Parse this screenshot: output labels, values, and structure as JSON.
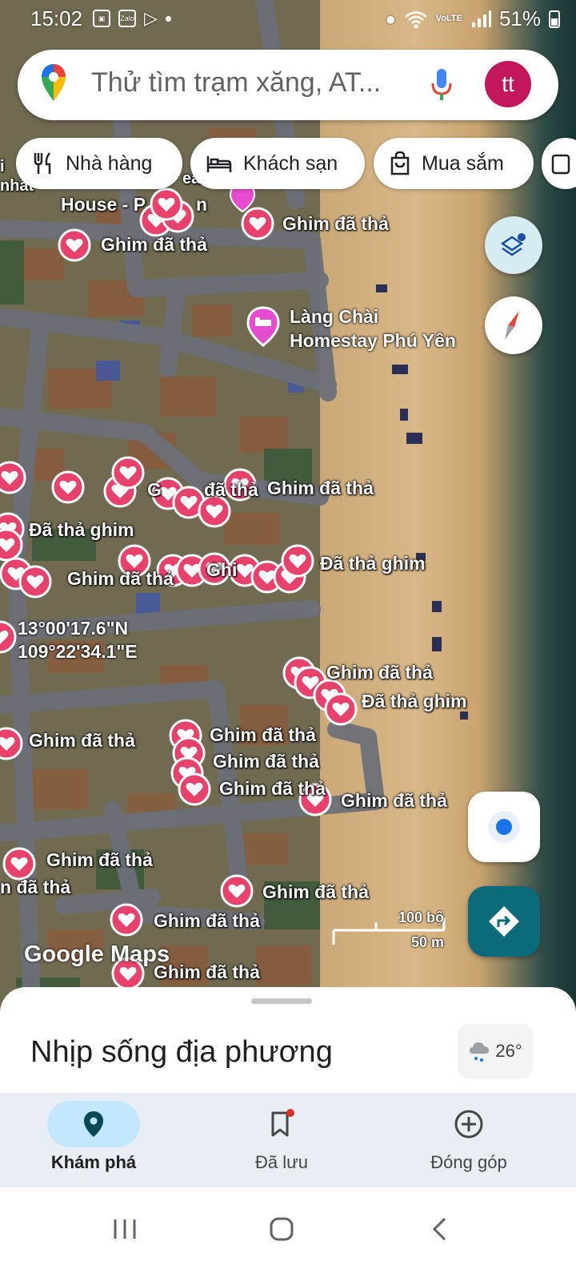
{
  "status_bar": {
    "time": "15:02",
    "app_icons": [
      "gallery-icon",
      "zalo-icon",
      "play-icon",
      "dot"
    ],
    "zalo_text": "Zalo",
    "network": "VoLTE",
    "battery": "51%"
  },
  "search": {
    "placeholder": "Thử tìm trạm xăng, AT...",
    "avatar_initials": "tt"
  },
  "chips": [
    {
      "label": "Nhà hàng",
      "icon": "fork-knife-icon"
    },
    {
      "label": "Khách sạn",
      "icon": "bed-icon"
    },
    {
      "label": "Mua sắm",
      "icon": "shopping-bag-icon"
    }
  ],
  "map": {
    "place_labels": {
      "fragment_left": "i\nnhất",
      "house": "House - P",
      "house_tail": "n",
      "reach": "each"
    },
    "poi": {
      "name_line1": "Làng Chài",
      "name_line2": "Homestay Phú Yên"
    },
    "coordinates": {
      "lat": "13°00'17.6\"N",
      "lng": "109°22'34.1\"E"
    },
    "pin_labels": [
      "Ghim đã thả",
      "Ghim đã thả",
      "Ghim đã thả",
      "Đã thả ghim",
      "Ghim đã thả",
      "Đã thả ghim",
      "Ghim đã thả",
      "Đã thả ghim",
      "Ghim đã thả",
      "Ghim đã thả",
      "Ghim đã thả",
      "Ghim đã thả",
      "Ghim đã thả",
      "Ghim đã thả",
      "n đã thả",
      "Ghim đã thả",
      "Ghim đã thả",
      "Ghim đã thả"
    ],
    "partial_labels": {
      "a": "G",
      "b": "đã thả",
      "c": "Ghi"
    },
    "scale": {
      "imperial": "100 bộ",
      "metric": "50 m"
    },
    "logo": "Google Maps"
  },
  "sheet": {
    "title": "Nhịp sống địa phương",
    "temperature": "26°"
  },
  "bottom_nav": [
    {
      "label": "Khám phá",
      "icon": "explore-pin-icon",
      "active": true
    },
    {
      "label": "Đã lưu",
      "icon": "bookmark-icon",
      "active": false
    },
    {
      "label": "Đóng góp",
      "icon": "add-circle-icon",
      "active": false
    }
  ],
  "colors": {
    "pin": "#e8416b",
    "accent": "#0b6b7a",
    "active_pill": "#c2e7ff",
    "avatar": "#c2185b"
  }
}
